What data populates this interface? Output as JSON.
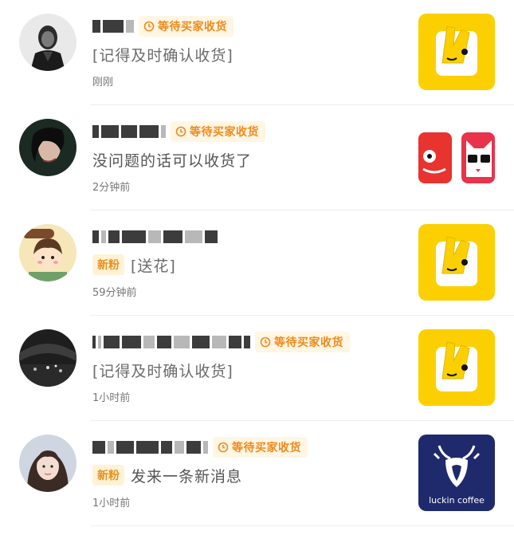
{
  "conversations": [
    {
      "tag": "等待买家收货",
      "message": "[记得及时确认收货]",
      "time": "刚刚",
      "thumb": "yellow-bunny-app-icon"
    },
    {
      "tag": "等待买家收货",
      "message": "没问题的话可以收货了",
      "time": "2分钟前",
      "thumb": "red-cat-app-icons"
    },
    {
      "fan_tag": "新粉",
      "message": "[送花]",
      "time": "59分钟前",
      "thumb": "yellow-bunny-app-icon"
    },
    {
      "tag": "等待买家收货",
      "message": "[记得及时确认收货]",
      "time": "1小时前",
      "thumb": "yellow-bunny-app-icon"
    },
    {
      "tag": "等待买家收货",
      "fan_tag": "新粉",
      "message": "发来一条新消息",
      "time": "1小时前",
      "thumb": "luckin-coffee-logo",
      "thumb_text": "luckin coffee"
    }
  ],
  "colors": {
    "tag_text": "#f08a1c",
    "tag_bg": "#fff6e4",
    "yellow_icon": "#fcd000",
    "luckin_navy": "#1f2a6d",
    "red_icon": "#e8332e"
  }
}
